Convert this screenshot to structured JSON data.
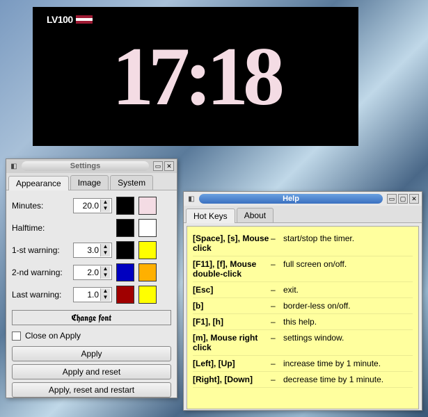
{
  "clock": {
    "badge_text": "LV100",
    "time": "17:18"
  },
  "settings": {
    "title": "Settings",
    "tabs": {
      "appearance": "Appearance",
      "image": "Image",
      "system": "System"
    },
    "labels": {
      "minutes": "Minutes:",
      "halftime": "Halftime:",
      "warn1": "1-st warning:",
      "warn2": "2-nd warning:",
      "last": "Last warning:"
    },
    "values": {
      "minutes": "20.0",
      "warn1": "3.0",
      "warn2": "2.0",
      "last": "1.0"
    },
    "colors": {
      "minutes_a": "#000000",
      "minutes_b": "#f4dce4",
      "halftime_a": "#000000",
      "halftime_b": "#ffffff",
      "warn1_a": "#000000",
      "warn1_b": "#ffff00",
      "warn2_a": "#0000c0",
      "warn2_b": "#ffb000",
      "last_a": "#a00000",
      "last_b": "#ffff00"
    },
    "change_font": "Change font",
    "close_on_apply": "Close on Apply",
    "buttons": {
      "apply": "Apply",
      "apply_reset": "Apply and reset",
      "apply_reset_restart": "Apply, reset and restart"
    }
  },
  "help": {
    "title": "Help",
    "tabs": {
      "hotkeys": "Hot Keys",
      "about": "About"
    },
    "sep": "–",
    "rows": [
      {
        "keys": "[Space], [s], Mouse click",
        "desc": "start/stop the timer."
      },
      {
        "keys": "[F11], [f], Mouse double-click",
        "desc": "full screen on/off."
      },
      {
        "keys": "[Esc]",
        "desc": "exit."
      },
      {
        "keys": "[b]",
        "desc": "border-less on/off."
      },
      {
        "keys": "[F1], [h]",
        "desc": "this help."
      },
      {
        "keys": "[m], Mouse right click",
        "desc": "settings window."
      },
      {
        "keys": "[Left], [Up]",
        "desc": "increase time by 1 minute."
      },
      {
        "keys": "[Right], [Down]",
        "desc": "decrease time by 1 minute."
      }
    ]
  }
}
